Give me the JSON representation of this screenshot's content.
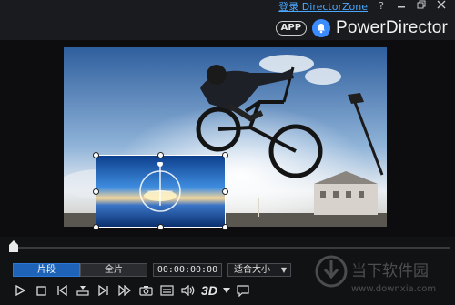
{
  "titlebar": {
    "login_link": "登录 DirectorZone",
    "help_label": "?",
    "app_badge": "APP",
    "brand_name": "PowerDirector",
    "icons": [
      "help-icon",
      "minimize-icon",
      "restore-icon",
      "close-icon",
      "bell-icon"
    ]
  },
  "preview": {
    "main_clip": "bmx-rider-photo",
    "pip_clip": "sunset-water-photo"
  },
  "timeline": {
    "position": 0
  },
  "controls": {
    "tab_clip": "片段",
    "tab_movie": "全片",
    "timecode": "00:00:00:00",
    "fit_option": "适合大小",
    "three_d_label": "3D",
    "icons": [
      "play-icon",
      "stop-icon",
      "previous-frame-icon",
      "split-icon",
      "next-frame-icon",
      "fast-forward-icon",
      "snapshot-icon",
      "subtitle-icon",
      "volume-icon",
      "3d-icon",
      "dropdown-arrow-icon",
      "external-display-icon"
    ]
  },
  "watermark": {
    "text_cn": "当下软件园",
    "text_en": "www.downxia.com"
  }
}
